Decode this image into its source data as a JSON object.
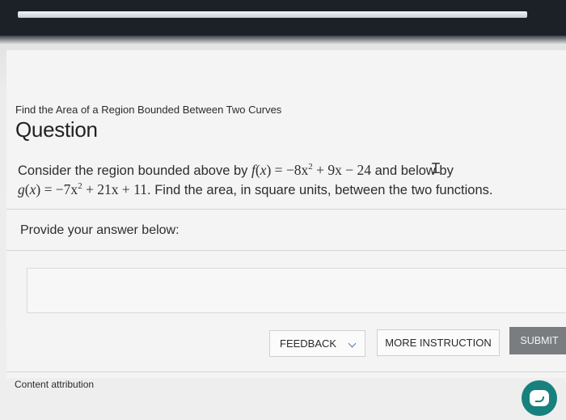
{
  "header": {
    "breadcrumb": "Find the Area of a Region Bounded Between Two Curves",
    "title": "Question"
  },
  "question": {
    "lead": "Consider the region bounded above by ",
    "f_name": "f",
    "f_var": "x",
    "f_eq": " = −8x",
    "f_exp": "2",
    "f_tail": " + 9x − 24",
    "mid": " and below by",
    "g_name": "g",
    "g_var": "x",
    "g_eq": " = −7x",
    "g_exp": "2",
    "g_tail": " + 21x + 11",
    "end": ". Find the area, in square units, between the two functions."
  },
  "answer": {
    "prompt": "Provide your answer below:",
    "value": ""
  },
  "buttons": {
    "feedback": "FEEDBACK",
    "more": "MORE INSTRUCTION",
    "submit": "SUBMIT"
  },
  "footer": {
    "attribution": "Content attribution"
  },
  "colors": {
    "submit_bg": "#7a7d80",
    "chat_fab": "#18817e",
    "chevron": "#4a78b5"
  },
  "icons": {
    "chat": "chat-bubble-icon",
    "chevron": "chevron-down-icon",
    "cursor": "text-cursor-icon"
  }
}
